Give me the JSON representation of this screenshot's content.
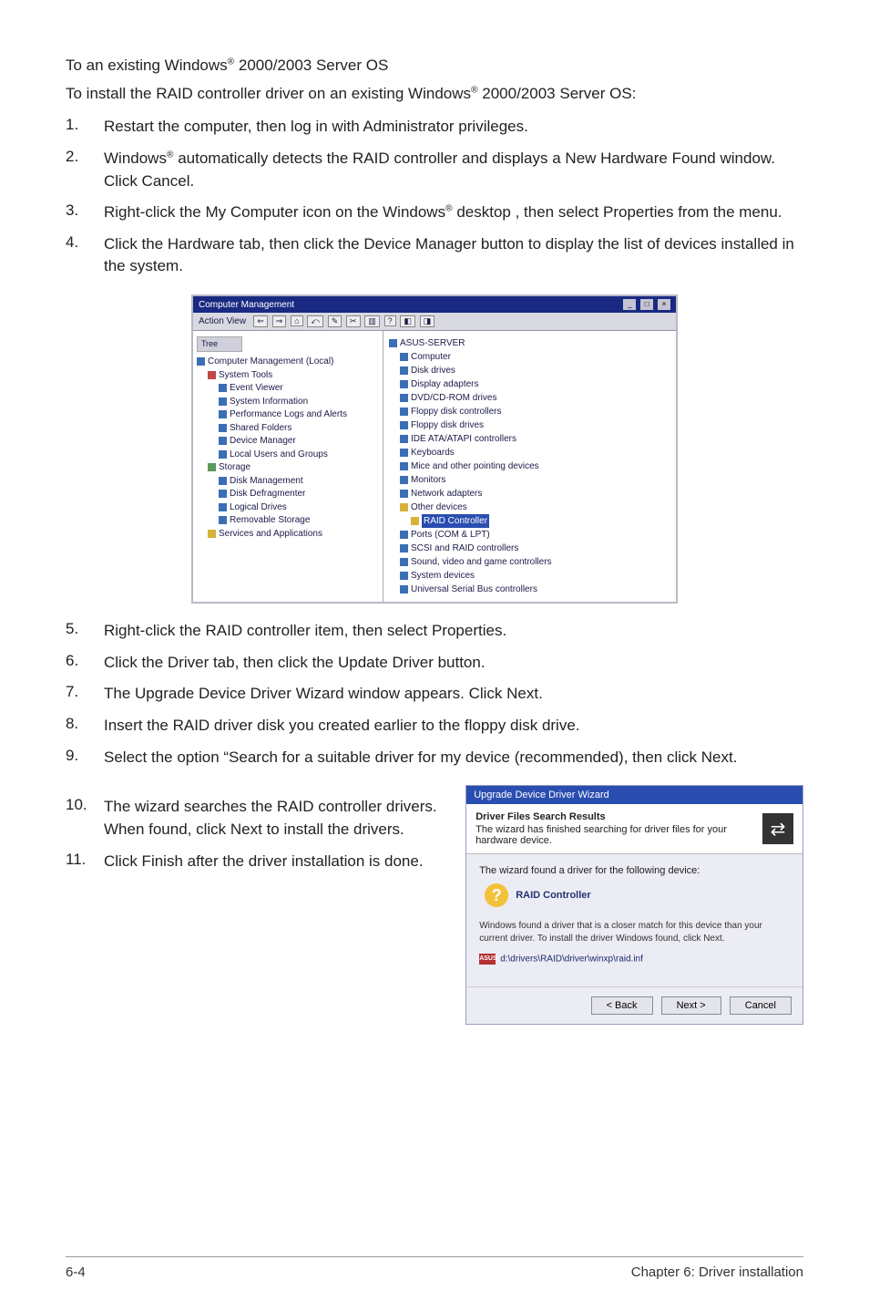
{
  "intro": {
    "line1_a": "To an existing Windows",
    "line1_b": " 2000/2003 Server OS",
    "line2_a": "To install the RAID controller driver on an existing Windows",
    "line2_b": " 2000/2003 Server OS:",
    "reg": "®"
  },
  "steps_a": [
    {
      "n": "1.",
      "t": "Restart the computer, then log in with Administrator privileges."
    },
    {
      "n": "2.",
      "t_a": "Windows",
      "t_b": " automatically detects the RAID controller and displays a New Hardware Found window. Click Cancel."
    },
    {
      "n": "3.",
      "t_a": "Right-click the My Computer icon on the Windows",
      "t_b": " desktop , then select Properties from the menu."
    },
    {
      "n": "4.",
      "t": "Click the Hardware tab, then click the Device Manager button to display the list of devices installed in the system."
    }
  ],
  "mmc": {
    "title": "Computer Management",
    "min": "_",
    "max": "□",
    "close": "×",
    "menu": "Action   View",
    "tb": [
      "⇐",
      "⇒",
      "⌂",
      "⤺",
      "✎",
      "✂",
      "▥",
      "?",
      "◧",
      "◨"
    ],
    "tree_hdr": "Tree",
    "left_root": "Computer Management (Local)",
    "left": [
      "System Tools",
      "Event Viewer",
      "System Information",
      "Performance Logs and Alerts",
      "Shared Folders",
      "Device Manager",
      "Local Users and Groups",
      "Storage",
      "Disk Management",
      "Disk Defragmenter",
      "Logical Drives",
      "Removable Storage",
      "Services and Applications"
    ],
    "right_root": "ASUS-SERVER",
    "right": [
      "Computer",
      "Disk drives",
      "Display adapters",
      "DVD/CD-ROM drives",
      "Floppy disk controllers",
      "Floppy disk drives",
      "IDE ATA/ATAPI controllers",
      "Keyboards",
      "Mice and other pointing devices",
      "Monitors",
      "Network adapters",
      "Other devices",
      "RAID Controller",
      "Ports (COM & LPT)",
      "SCSI and RAID controllers",
      "Sound, video and game controllers",
      "System devices",
      "Universal Serial Bus controllers"
    ]
  },
  "steps_b": [
    {
      "n": "5.",
      "t": "Right-click the RAID controller item, then select Properties."
    },
    {
      "n": "6.",
      "t": "Click the Driver tab, then click the Update Driver button."
    },
    {
      "n": "7.",
      "t": "The Upgrade Device Driver Wizard window appears. Click Next."
    },
    {
      "n": "8.",
      "t": "Insert the RAID driver disk you created earlier to the floppy disk drive."
    },
    {
      "n": "9.",
      "t": "Select the option “Search for a suitable driver for my device (recommended), then click Next."
    },
    {
      "n": "10.",
      "t": "The wizard searches the RAID controller drivers. When found, click Next to install the drivers."
    },
    {
      "n": "11.",
      "t": "Click Finish after the driver installation is done."
    }
  ],
  "wizard": {
    "hdr": "Upgrade Device Driver Wizard",
    "title": "Driver Files Search Results",
    "sub": "The wizard has finished searching for driver files for your hardware device.",
    "body1": "The wizard found a driver for the following device:",
    "found": "RAID Controller",
    "note": "Windows found a driver that is a closer match for this device than your current driver. To install the driver Windows found, click Next.",
    "flag": "ASUS",
    "path": "d:\\drivers\\RAID\\driver\\winxp\\raid.inf",
    "back": "< Back",
    "next": "Next >",
    "cancel": "Cancel",
    "dicon": "⇄"
  },
  "footer": {
    "left": "6-4",
    "right": "Chapter 6: Driver installation"
  }
}
